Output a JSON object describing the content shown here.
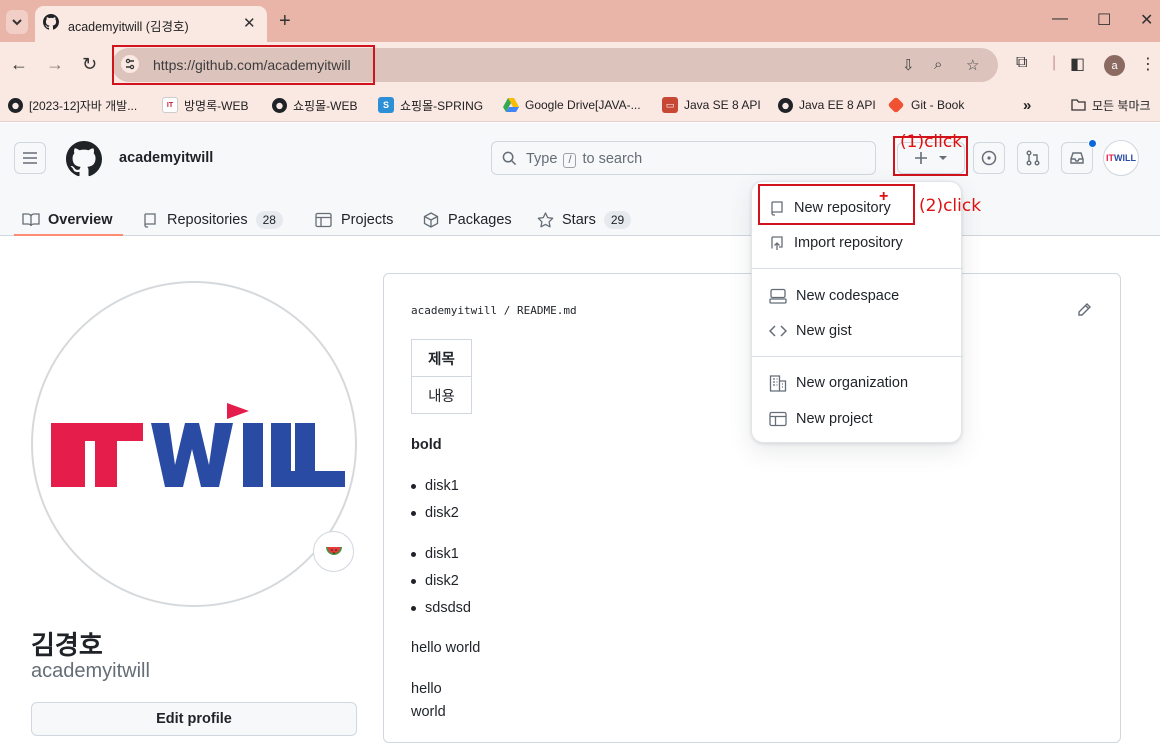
{
  "browser": {
    "tab_title": "academyitwill (김경호)",
    "url": "https://github.com/academyitwill",
    "profile_initial": "a",
    "bookmarks": [
      {
        "label": "[2023-12]자바 개발...",
        "icon": "github-icon"
      },
      {
        "label": "방명록-WEB",
        "icon": "itwill-icon"
      },
      {
        "label": "쇼핑몰-WEB",
        "icon": "github-icon"
      },
      {
        "label": "쇼핑몰-SPRING",
        "icon": "spring-icon"
      },
      {
        "label": "Google Drive[JAVA-...",
        "icon": "google-drive-icon"
      },
      {
        "label": "Java SE 8 API",
        "icon": "oracle-icon"
      },
      {
        "label": "Java EE 8 API",
        "icon": "github-icon"
      },
      {
        "label": "Git - Book",
        "icon": "git-icon"
      }
    ],
    "more_bookmarks": "»",
    "all_bookmarks": "모든 북마크"
  },
  "github": {
    "username": "academyitwill",
    "search_placeholder_pre": "Type",
    "search_key": "/",
    "search_placeholder_post": "to search",
    "tabs": [
      {
        "label": "Overview",
        "count": null
      },
      {
        "label": "Repositories",
        "count": "28"
      },
      {
        "label": "Projects",
        "count": null
      },
      {
        "label": "Packages",
        "count": null
      },
      {
        "label": "Stars",
        "count": "29"
      }
    ],
    "create_menu": [
      "New repository",
      "Import repository",
      "New codespace",
      "New gist",
      "New organization",
      "New project"
    ]
  },
  "annotations": {
    "step1": "(1)click",
    "step2": "(2)click",
    "color": "#d0131d"
  },
  "profile": {
    "name": "김경호",
    "login": "academyitwill",
    "edit_button": "Edit profile",
    "avatar_text_red": "IT",
    "avatar_text_blue": "WILL",
    "status_emoji": "watermelon-icon"
  },
  "readme": {
    "owner": "academyitwill",
    "separator": "/",
    "file": "README.md",
    "table_header": "제목",
    "table_cell": "내용",
    "bold_text": "bold",
    "list1": [
      "disk1",
      "disk2"
    ],
    "list2": [
      "disk1",
      "disk2",
      "sdsdsd"
    ],
    "p1": "hello world",
    "p2_line1": "hello",
    "p2_line2": "world"
  }
}
